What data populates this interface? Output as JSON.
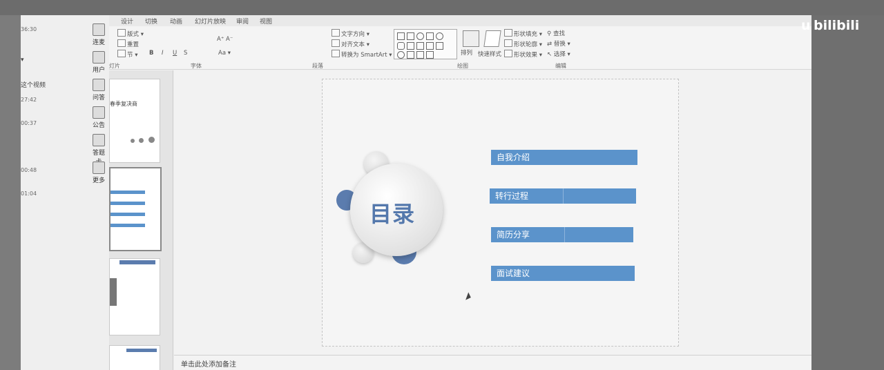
{
  "watermark": {
    "brand": "bilibili",
    "prefix": "u"
  },
  "ribbon": {
    "tabs": [
      "设计",
      "切换",
      "动画",
      "幻灯片放映",
      "审阅",
      "视图"
    ],
    "groups": {
      "slides": "幻灯片",
      "font": "字体",
      "paragraph": "段落",
      "drawing": "绘图",
      "editing": "编辑"
    },
    "layout_label": "版式",
    "reset_label": "重置",
    "section_label": "节",
    "text_direction_label": "文字方向",
    "align_text_label": "对齐文本",
    "smartart_label": "转换为 SmartArt",
    "arrange_label": "排列",
    "quick_styles_label": "快速样式",
    "shape_fill_label": "形状填充",
    "shape_outline_label": "形状轮廓",
    "shape_effects_label": "形状效果",
    "find_label": "查找",
    "replace_label": "替换",
    "select_label": "选择"
  },
  "side_panel": {
    "times": [
      "36:30",
      "27:42",
      "00:37",
      "00:48",
      "01:04"
    ],
    "mark_text": "这个视频",
    "buttons": [
      "连麦",
      "用户",
      "问答",
      "公告",
      "答题卡",
      "更多"
    ]
  },
  "thumbnail_text": "春季复决商",
  "slide": {
    "center_title": "目录",
    "items": [
      "自我介绍",
      "转行过程",
      "简历分享",
      "面试建议"
    ]
  },
  "notes_placeholder": "单击此处添加备注",
  "colors": {
    "accent_blue": "#5b93cb",
    "title_blue": "#5478ac"
  }
}
